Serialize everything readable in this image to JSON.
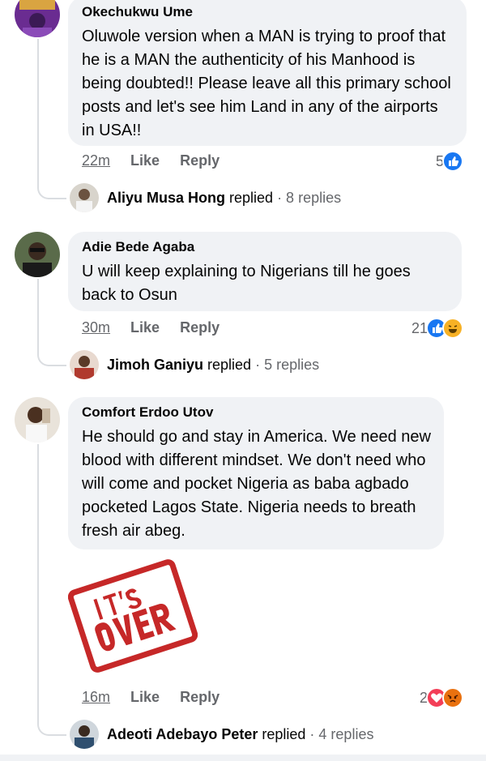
{
  "comments": [
    {
      "author": "Okechukwu Ume",
      "text": "Oluwole version when a MAN is trying to proof that he is a MAN the authenticity of his Manhood is being doubted!! Please leave all this primary school posts and let's see him Land in any of the airports in USA!!",
      "time": "22m",
      "like_label": "Like",
      "reply_label": "Reply",
      "reaction_count": "5",
      "reactions": [
        "like-icon"
      ],
      "replies": {
        "name": "Aliyu Musa Hong",
        "verb": "replied",
        "count": "· 8 replies"
      }
    },
    {
      "author": "Adie Bede Agaba",
      "text": "U will keep explaining to Nigerians till he goes back to Osun",
      "time": "30m",
      "like_label": "Like",
      "reply_label": "Reply",
      "reaction_count": "21",
      "reactions": [
        "like-icon",
        "haha-icon"
      ],
      "replies": {
        "name": "Jimoh Ganiyu",
        "verb": "replied",
        "count": "· 5 replies"
      }
    },
    {
      "author": "Comfort Erdoo Utov",
      "text": "He should go and stay in America. We need new blood with different mindset. We don't need who will come and pocket Nigeria as baba agbado pocketed Lagos State. Nigeria needs to breath fresh air abeg.",
      "sticker_text": "IT'S OVER",
      "time": "16m",
      "like_label": "Like",
      "reply_label": "Reply",
      "reaction_count": "2",
      "reactions": [
        "love-icon",
        "angry-icon"
      ],
      "replies": {
        "name": "Adeoti Adebayo Peter",
        "verb": "replied",
        "count": "· 4 replies"
      }
    }
  ],
  "colors": {
    "like": "#1877f2",
    "love": "#f33e58",
    "haha": "#f7b125",
    "angry": "#e9710f",
    "stamp": "#c62828"
  }
}
